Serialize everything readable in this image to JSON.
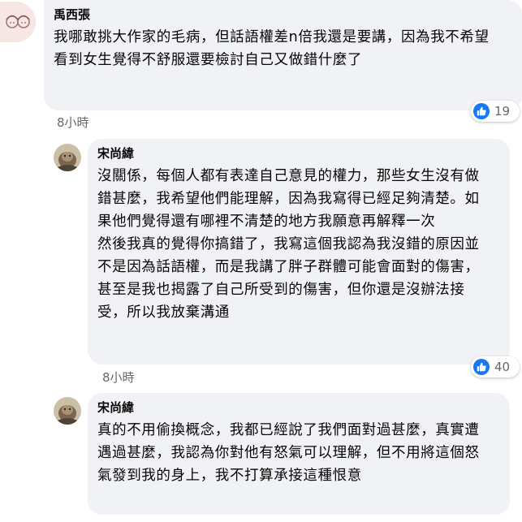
{
  "comments": [
    {
      "author": "禹西張",
      "text": "我哪敢挑大作家的毛病，但話語權差n倍我還是要講，因為我不希望看到女生覺得不舒服還要檢討自己又做錯什麼了",
      "time": "8小時",
      "reaction_count": "19",
      "reaction_icon": "like-icon"
    },
    {
      "author": "宋尚緯",
      "text": "沒關係，每個人都有表達自己意見的權力，那些女生沒有做錯甚麼，我希望他們能理解，因為我寫得已經足夠清楚。如果他們覺得還有哪裡不清楚的地方我願意再解釋一次\n然後我真的覺得你搞錯了，我寫這個我認為我沒錯的原因並不是因為話語權，而是我講了胖子群體可能會面對的傷害，甚至是我也揭露了自己所受到的傷害，但你還是沒辦法接受，所以我放棄溝通",
      "time": "8小時",
      "reaction_count": "40",
      "reaction_icon": "like-icon"
    },
    {
      "author": "宋尚緯",
      "text": "真的不用偷換概念，我都已經說了我們面對過甚麼，真實遭遇過甚麼，我認為你對他有怒氣可以理解，但不用將這個怒氣發到我的身上，我不打算承接這種恨意"
    }
  ],
  "colors": {
    "bubble": "#f0f2f5",
    "like_blue": "#1877f2",
    "meta_text": "#65676b"
  }
}
